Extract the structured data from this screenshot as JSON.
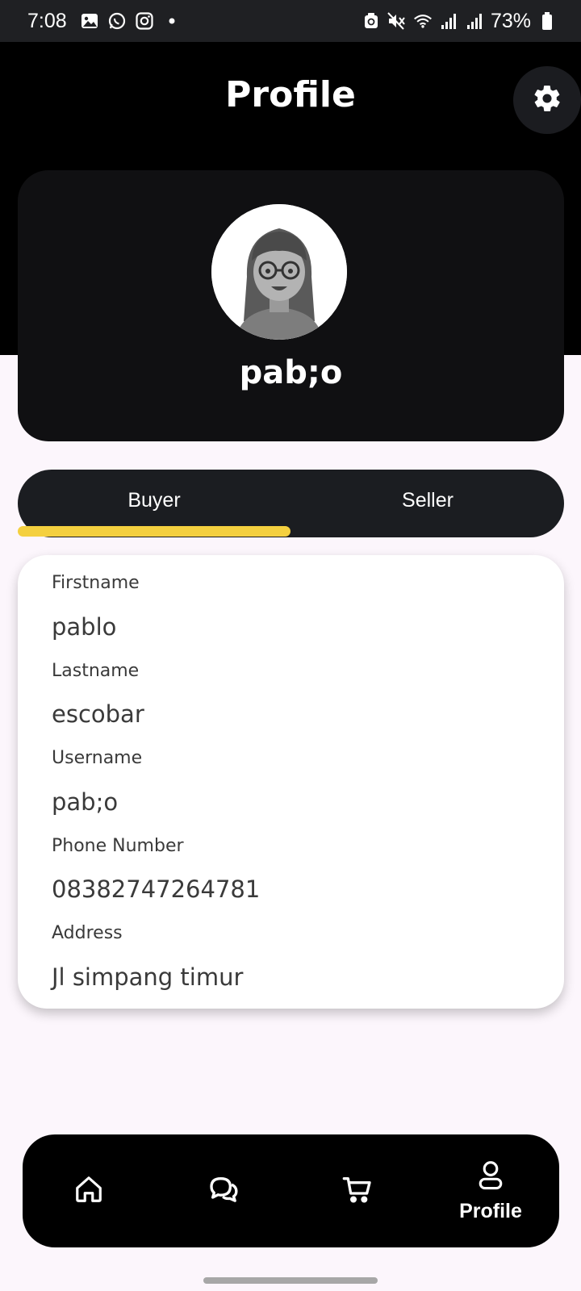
{
  "status_bar": {
    "time": "7:08",
    "battery": "73%",
    "left_icons": [
      "gallery-icon",
      "whatsapp-icon",
      "instagram-icon",
      "dot-icon"
    ],
    "right_icons": [
      "recycle-icon",
      "mute-icon",
      "wifi-icon",
      "signal-icon",
      "signal-icon",
      "battery-icon"
    ]
  },
  "header": {
    "title": "Profile",
    "settings_icon": "gear-icon"
  },
  "profile": {
    "name": "pab;o",
    "avatar": "avatar-3d-person"
  },
  "tabs": {
    "items": [
      {
        "label": "Buyer",
        "selected": true
      },
      {
        "label": "Seller",
        "selected": false
      }
    ],
    "indicator_color": "#f4d03f"
  },
  "info": {
    "fields": [
      {
        "label": "Firstname",
        "value": "pablo"
      },
      {
        "label": "Lastname",
        "value": "escobar"
      },
      {
        "label": "Username",
        "value": "pab;o"
      },
      {
        "label": "Phone Number",
        "value": "08382747264781"
      },
      {
        "label": "Address",
        "value": "Jl simpang timur"
      }
    ]
  },
  "bottom_nav": {
    "items": [
      {
        "icon": "home-icon",
        "label": ""
      },
      {
        "icon": "chat-icon",
        "label": ""
      },
      {
        "icon": "cart-icon",
        "label": ""
      },
      {
        "icon": "user-icon",
        "label": "Profile",
        "active": true
      }
    ]
  },
  "colors": {
    "header_bg": "#000000",
    "page_bg": "#fcf6fc",
    "accent": "#f4d03f"
  }
}
